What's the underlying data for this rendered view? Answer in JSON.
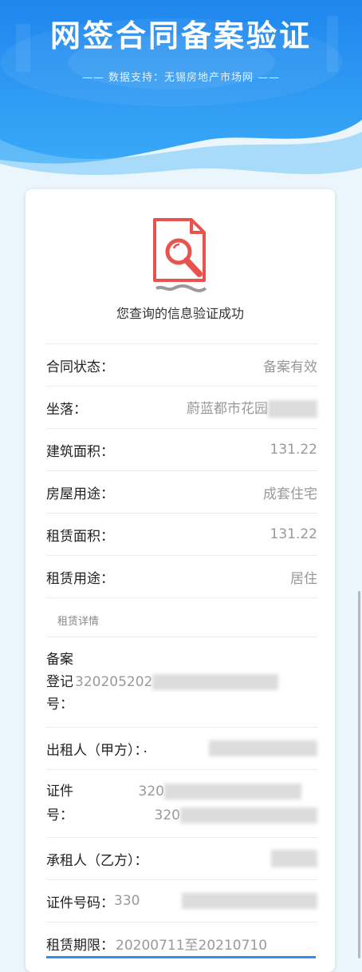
{
  "header": {
    "title": "网签合同备案验证",
    "subtitle": "—— 数据支持：无锡房地产市场网 ——"
  },
  "result": {
    "icon": "document-search-icon",
    "message": "您查询的信息验证成功"
  },
  "fields": [
    {
      "label": "合同状态：",
      "value": "备案有效"
    },
    {
      "label": "坐落：",
      "value": "蔚蓝都市花园"
    },
    {
      "label": "建筑面积：",
      "value": "131.22"
    },
    {
      "label": "房屋用途：",
      "value": "成套住宅"
    },
    {
      "label": "租赁面积：",
      "value": "131.22"
    },
    {
      "label": "租赁用途：",
      "value": "居住"
    }
  ],
  "details": {
    "section_label": "租赁详情",
    "registration": {
      "label_lines": [
        "备案",
        "登记",
        "号："
      ],
      "value": "320205202"
    },
    "lessor": {
      "label": "出租人（甲方）：",
      "value": "."
    },
    "lessor_id": {
      "label_lines": [
        "证件",
        "号："
      ],
      "value_lines": [
        "320",
        "320"
      ]
    },
    "lessee": {
      "label": "承租人（乙方）："
    },
    "lessee_id": {
      "label": "证件号码：",
      "value": "330"
    },
    "period": {
      "label": "租赁期限：",
      "value": "20200711至20210710"
    }
  },
  "colors": {
    "primary": "#2d8ef5",
    "icon_red": "#e9534d"
  }
}
